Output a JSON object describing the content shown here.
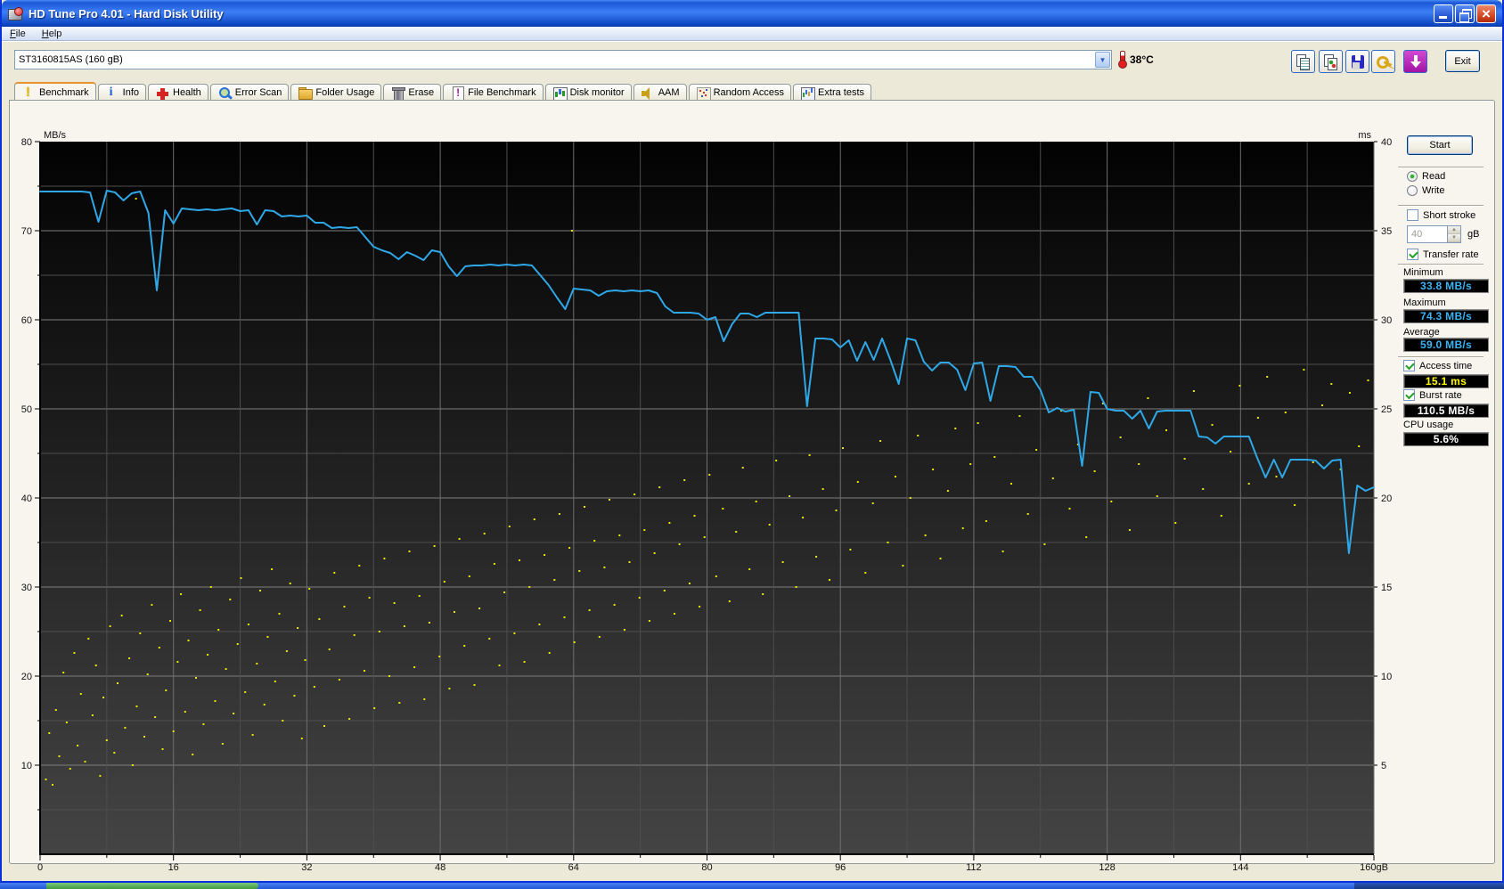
{
  "window": {
    "title": "HD Tune Pro 4.01 - Hard Disk Utility",
    "menu": [
      "File",
      "Help"
    ]
  },
  "toolbar": {
    "drive": "ST3160815AS (160 gB)",
    "temperature": "38°C",
    "exit_label": "Exit"
  },
  "tabs": [
    {
      "label": "Benchmark",
      "active": true
    },
    {
      "label": "Info"
    },
    {
      "label": "Health"
    },
    {
      "label": "Error Scan"
    },
    {
      "label": "Folder Usage"
    },
    {
      "label": "Erase"
    },
    {
      "label": "File Benchmark"
    },
    {
      "label": "Disk monitor"
    },
    {
      "label": "AAM"
    },
    {
      "label": "Random Access"
    },
    {
      "label": "Extra tests"
    }
  ],
  "panel": {
    "start_label": "Start",
    "read_label": "Read",
    "write_label": "Write",
    "short_stroke_label": "Short stroke",
    "short_stroke_value": "40",
    "gb_label": "gB",
    "transfer_rate_label": "Transfer rate",
    "minimum_label": "Minimum",
    "minimum_value": "33.8 MB/s",
    "maximum_label": "Maximum",
    "maximum_value": "74.3 MB/s",
    "average_label": "Average",
    "average_value": "59.0 MB/s",
    "access_time_label": "Access time",
    "access_time_value": "15.1 ms",
    "burst_rate_label": "Burst rate",
    "burst_rate_value": "110.5 MB/s",
    "cpu_usage_label": "CPU usage",
    "cpu_usage_value": "5.6%"
  },
  "chart_data": {
    "type": "line",
    "title": "HD Tune read benchmark: transfer rate line (left axis, MB/s) with access-time scatter (right axis, ms)",
    "x_axis": {
      "min": 0,
      "max": 160,
      "tick_step": 16,
      "minor_step": 8,
      "tick_labels": [
        "0",
        "16",
        "32",
        "48",
        "64",
        "80",
        "96",
        "112",
        "128",
        "144",
        "160gB"
      ]
    },
    "y_left": {
      "label": "MB/s",
      "min": 0,
      "max": 80,
      "tick_step": 10,
      "minor_step": 5,
      "tick_labels": [
        "10",
        "20",
        "30",
        "40",
        "50",
        "60",
        "70",
        "80"
      ]
    },
    "y_right": {
      "label": "ms",
      "min": 0,
      "max": 40,
      "tick_step": 5,
      "tick_labels": [
        "5",
        "10",
        "15",
        "20",
        "25",
        "30",
        "35",
        "40"
      ]
    },
    "grid": true,
    "line_color": "#2fa8e8",
    "dot_color": "#e8e800",
    "transfer_rate_mbps": {
      "x_step_gb": 1,
      "values": [
        74.4,
        74.4,
        74.4,
        74.4,
        74.4,
        74.4,
        74.3,
        71.0,
        74.5,
        74.3,
        73.4,
        74.2,
        74.4,
        72.0,
        63.3,
        72.3,
        70.8,
        72.5,
        72.4,
        72.3,
        72.4,
        72.3,
        72.4,
        72.5,
        72.2,
        72.3,
        70.7,
        72.3,
        72.2,
        71.6,
        71.7,
        71.6,
        71.7,
        70.9,
        70.9,
        70.3,
        70.4,
        70.3,
        70.4,
        69.3,
        68.2,
        67.8,
        67.5,
        66.8,
        67.6,
        67.2,
        66.7,
        67.8,
        67.6,
        66.0,
        64.9,
        66.0,
        66.1,
        66.1,
        66.2,
        66.1,
        66.2,
        66.1,
        66.2,
        66.1,
        65.0,
        63.9,
        62.5,
        61.2,
        63.5,
        63.4,
        63.3,
        62.7,
        63.2,
        63.3,
        63.2,
        63.3,
        63.2,
        63.3,
        63.0,
        61.5,
        60.8,
        60.8,
        60.8,
        60.7,
        60.0,
        60.3,
        57.6,
        59.5,
        60.7,
        60.7,
        60.3,
        60.8,
        60.8,
        60.8,
        60.8,
        60.8,
        50.3,
        57.9,
        57.9,
        57.8,
        56.9,
        57.7,
        55.4,
        57.5,
        55.5,
        57.9,
        55.5,
        52.8,
        57.9,
        57.7,
        55.3,
        54.3,
        55.2,
        55.2,
        54.4,
        52.1,
        55.1,
        55.2,
        50.9,
        54.8,
        54.8,
        54.7,
        53.6,
        53.6,
        52.1,
        49.6,
        50.1,
        49.7,
        49.9,
        43.6,
        51.9,
        51.8,
        50.0,
        49.8,
        49.8,
        48.9,
        49.8,
        47.8,
        49.7,
        49.8,
        49.8,
        49.8,
        49.8,
        46.9,
        46.8,
        46.1,
        46.9,
        46.9,
        46.9,
        46.9,
        44.5,
        42.3,
        44.3,
        42.3,
        44.3,
        44.3,
        44.3,
        44.2,
        43.3,
        44.2,
        44.3,
        33.8,
        41.4,
        40.8,
        41.2
      ]
    },
    "access_time_ms": {
      "points": [
        [
          0.7,
          4.2
        ],
        [
          1.1,
          6.8
        ],
        [
          1.5,
          3.9
        ],
        [
          1.9,
          8.1
        ],
        [
          2.3,
          5.5
        ],
        [
          2.8,
          10.2
        ],
        [
          3.2,
          7.4
        ],
        [
          3.6,
          4.8
        ],
        [
          4.1,
          11.3
        ],
        [
          4.5,
          6.1
        ],
        [
          4.9,
          9.0
        ],
        [
          5.4,
          5.2
        ],
        [
          5.8,
          12.1
        ],
        [
          6.3,
          7.8
        ],
        [
          6.7,
          10.6
        ],
        [
          7.2,
          4.4
        ],
        [
          7.6,
          8.8
        ],
        [
          8.0,
          6.4
        ],
        [
          8.4,
          12.8
        ],
        [
          8.9,
          5.7
        ],
        [
          9.3,
          9.6
        ],
        [
          9.8,
          13.4
        ],
        [
          10.2,
          7.1
        ],
        [
          10.7,
          11.0
        ],
        [
          11.1,
          5.0
        ],
        [
          11.5,
          36.8
        ],
        [
          11.6,
          8.3
        ],
        [
          12.0,
          12.4
        ],
        [
          12.5,
          6.6
        ],
        [
          12.9,
          10.1
        ],
        [
          13.4,
          14.0
        ],
        [
          13.8,
          7.7
        ],
        [
          14.3,
          11.6
        ],
        [
          14.7,
          5.9
        ],
        [
          15.1,
          9.2
        ],
        [
          15.6,
          13.1
        ],
        [
          16.0,
          6.9
        ],
        [
          16.5,
          10.8
        ],
        [
          16.9,
          14.6
        ],
        [
          17.4,
          8.0
        ],
        [
          17.8,
          12.0
        ],
        [
          18.3,
          5.6
        ],
        [
          18.7,
          9.9
        ],
        [
          19.2,
          13.7
        ],
        [
          19.6,
          7.3
        ],
        [
          20.1,
          11.2
        ],
        [
          20.5,
          15.0
        ],
        [
          21.0,
          8.6
        ],
        [
          21.4,
          12.6
        ],
        [
          21.9,
          6.2
        ],
        [
          22.3,
          10.4
        ],
        [
          22.8,
          14.3
        ],
        [
          23.2,
          7.9
        ],
        [
          23.7,
          11.8
        ],
        [
          24.1,
          15.5
        ],
        [
          24.6,
          9.1
        ],
        [
          25.0,
          12.9
        ],
        [
          25.5,
          6.7
        ],
        [
          26.0,
          10.7
        ],
        [
          26.4,
          14.8
        ],
        [
          26.9,
          8.4
        ],
        [
          27.3,
          12.2
        ],
        [
          27.8,
          16.0
        ],
        [
          28.2,
          9.7
        ],
        [
          28.7,
          13.5
        ],
        [
          29.1,
          7.5
        ],
        [
          29.6,
          11.4
        ],
        [
          30.0,
          15.2
        ],
        [
          30.5,
          8.9
        ],
        [
          30.9,
          12.7
        ],
        [
          31.4,
          6.5
        ],
        [
          31.8,
          10.9
        ],
        [
          32.3,
          14.9
        ],
        [
          32.9,
          9.4
        ],
        [
          33.5,
          13.2
        ],
        [
          34.1,
          7.2
        ],
        [
          34.7,
          11.5
        ],
        [
          35.3,
          15.8
        ],
        [
          35.9,
          9.8
        ],
        [
          36.5,
          13.9
        ],
        [
          37.1,
          7.6
        ],
        [
          37.7,
          12.3
        ],
        [
          38.3,
          16.2
        ],
        [
          38.9,
          10.3
        ],
        [
          39.5,
          14.4
        ],
        [
          40.1,
          8.2
        ],
        [
          40.7,
          12.5
        ],
        [
          41.3,
          16.6
        ],
        [
          41.9,
          10.0
        ],
        [
          42.5,
          14.1
        ],
        [
          43.1,
          8.5
        ],
        [
          43.7,
          12.8
        ],
        [
          44.3,
          17.0
        ],
        [
          44.9,
          10.5
        ],
        [
          45.5,
          14.5
        ],
        [
          46.1,
          8.7
        ],
        [
          46.7,
          13.0
        ],
        [
          47.3,
          17.3
        ],
        [
          47.9,
          11.1
        ],
        [
          48.5,
          15.3
        ],
        [
          49.1,
          9.3
        ],
        [
          49.7,
          13.6
        ],
        [
          50.3,
          17.7
        ],
        [
          50.9,
          11.7
        ],
        [
          51.5,
          15.6
        ],
        [
          52.1,
          9.5
        ],
        [
          52.7,
          13.8
        ],
        [
          53.3,
          18.0
        ],
        [
          53.9,
          12.1
        ],
        [
          54.5,
          16.3
        ],
        [
          55.1,
          10.6
        ],
        [
          55.7,
          14.7
        ],
        [
          56.3,
          18.4
        ],
        [
          56.9,
          12.4
        ],
        [
          57.5,
          16.5
        ],
        [
          58.1,
          10.8
        ],
        [
          58.7,
          15.0
        ],
        [
          59.3,
          18.8
        ],
        [
          59.9,
          12.9
        ],
        [
          60.5,
          16.8
        ],
        [
          61.1,
          11.3
        ],
        [
          61.7,
          15.4
        ],
        [
          62.3,
          19.1
        ],
        [
          62.9,
          13.3
        ],
        [
          63.5,
          17.2
        ],
        [
          63.8,
          35.0
        ],
        [
          64.1,
          11.9
        ],
        [
          64.7,
          15.9
        ],
        [
          65.3,
          19.5
        ],
        [
          65.9,
          13.7
        ],
        [
          66.5,
          17.6
        ],
        [
          67.1,
          12.2
        ],
        [
          67.7,
          16.1
        ],
        [
          68.3,
          19.9
        ],
        [
          68.9,
          14.0
        ],
        [
          69.5,
          17.9
        ],
        [
          70.1,
          12.6
        ],
        [
          70.7,
          16.4
        ],
        [
          71.3,
          20.2
        ],
        [
          71.9,
          14.4
        ],
        [
          72.5,
          18.2
        ],
        [
          73.1,
          13.1
        ],
        [
          73.7,
          16.9
        ],
        [
          74.3,
          20.6
        ],
        [
          74.9,
          14.8
        ],
        [
          75.5,
          18.6
        ],
        [
          76.1,
          13.5
        ],
        [
          76.7,
          17.4
        ],
        [
          77.3,
          21.0
        ],
        [
          77.9,
          15.2
        ],
        [
          78.5,
          19.0
        ],
        [
          79.1,
          13.9
        ],
        [
          79.7,
          17.8
        ],
        [
          80.3,
          21.3
        ],
        [
          81.1,
          15.6
        ],
        [
          81.9,
          19.4
        ],
        [
          82.7,
          14.2
        ],
        [
          83.5,
          18.1
        ],
        [
          84.3,
          21.7
        ],
        [
          85.1,
          16.0
        ],
        [
          85.9,
          19.8
        ],
        [
          86.7,
          14.6
        ],
        [
          87.5,
          18.5
        ],
        [
          88.3,
          22.1
        ],
        [
          89.1,
          16.4
        ],
        [
          89.9,
          20.1
        ],
        [
          90.7,
          15.0
        ],
        [
          91.5,
          18.9
        ],
        [
          92.3,
          22.4
        ],
        [
          93.1,
          16.7
        ],
        [
          93.9,
          20.5
        ],
        [
          94.7,
          15.4
        ],
        [
          95.5,
          19.3
        ],
        [
          96.3,
          22.8
        ],
        [
          97.2,
          17.1
        ],
        [
          98.1,
          20.9
        ],
        [
          99.0,
          15.8
        ],
        [
          99.9,
          19.7
        ],
        [
          100.8,
          23.2
        ],
        [
          101.7,
          17.5
        ],
        [
          102.6,
          21.2
        ],
        [
          103.5,
          16.2
        ],
        [
          104.4,
          20.0
        ],
        [
          105.3,
          23.5
        ],
        [
          106.2,
          17.9
        ],
        [
          107.1,
          21.6
        ],
        [
          108.0,
          16.6
        ],
        [
          108.9,
          20.4
        ],
        [
          109.8,
          23.9
        ],
        [
          110.7,
          18.3
        ],
        [
          111.6,
          21.9
        ],
        [
          112.5,
          24.2
        ],
        [
          113.5,
          18.7
        ],
        [
          114.5,
          22.3
        ],
        [
          115.5,
          17.0
        ],
        [
          116.5,
          20.8
        ],
        [
          117.5,
          24.6
        ],
        [
          118.5,
          19.1
        ],
        [
          119.5,
          22.7
        ],
        [
          120.5,
          17.4
        ],
        [
          121.5,
          21.1
        ],
        [
          122.5,
          24.9
        ],
        [
          123.5,
          19.4
        ],
        [
          124.5,
          23.0
        ],
        [
          125.5,
          17.8
        ],
        [
          126.5,
          21.5
        ],
        [
          127.5,
          25.3
        ],
        [
          128.5,
          19.8
        ],
        [
          129.6,
          23.4
        ],
        [
          130.7,
          18.2
        ],
        [
          131.8,
          21.9
        ],
        [
          132.9,
          25.6
        ],
        [
          134.0,
          20.1
        ],
        [
          135.1,
          23.8
        ],
        [
          136.2,
          18.6
        ],
        [
          137.3,
          22.2
        ],
        [
          138.4,
          26.0
        ],
        [
          139.5,
          20.5
        ],
        [
          140.6,
          24.1
        ],
        [
          141.7,
          19.0
        ],
        [
          142.8,
          22.6
        ],
        [
          143.9,
          26.3
        ],
        [
          145.0,
          20.8
        ],
        [
          146.1,
          24.5
        ],
        [
          147.2,
          26.8
        ],
        [
          148.3,
          21.2
        ],
        [
          149.4,
          24.8
        ],
        [
          150.5,
          19.6
        ],
        [
          151.6,
          27.2
        ],
        [
          152.7,
          22.0
        ],
        [
          153.8,
          25.2
        ],
        [
          154.9,
          26.4
        ],
        [
          156.0,
          21.6
        ],
        [
          157.1,
          25.9
        ],
        [
          158.2,
          22.9
        ],
        [
          159.3,
          26.6
        ]
      ]
    }
  }
}
